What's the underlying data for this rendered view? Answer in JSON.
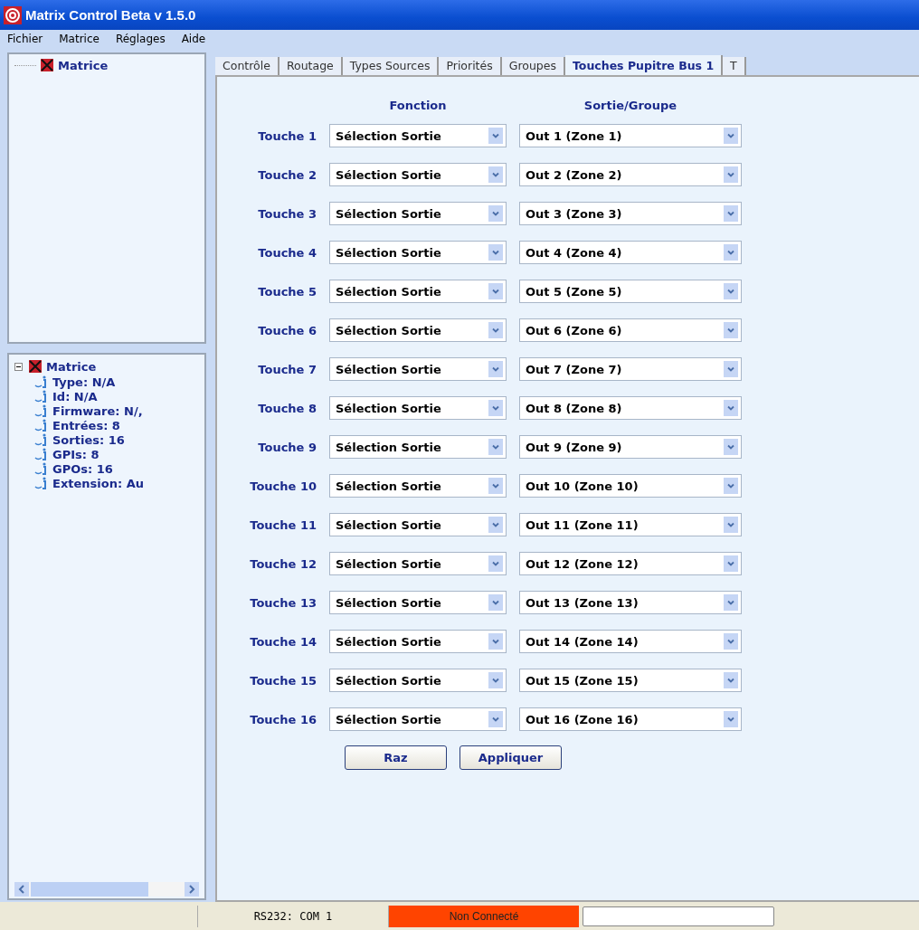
{
  "window": {
    "title": "Matrix Control Beta v 1.5.0"
  },
  "menu": [
    "Fichier",
    "Matrice",
    "Réglages",
    "Aide"
  ],
  "device_list": {
    "items": [
      {
        "label": "Matrice",
        "selected": false
      }
    ]
  },
  "info_tree": {
    "label": "Matrice",
    "expanded": true,
    "children": [
      {
        "label": "Type: N/A"
      },
      {
        "label": "Id: N/A"
      },
      {
        "label": "Firmware: N/,"
      },
      {
        "label": "Entrées: 8"
      },
      {
        "label": "Sorties: 16"
      },
      {
        "label": "GPIs: 8"
      },
      {
        "label": "GPOs: 16"
      },
      {
        "label": "Extension: Au"
      }
    ]
  },
  "tabs": [
    {
      "label": "Contrôle",
      "selected": false
    },
    {
      "label": "Routage",
      "selected": false
    },
    {
      "label": "Types Sources",
      "selected": false
    },
    {
      "label": "Priorités",
      "selected": false
    },
    {
      "label": "Groupes",
      "selected": false
    },
    {
      "label": "Touches Pupitre Bus 1",
      "selected": true
    },
    {
      "label": "T",
      "selected": false
    }
  ],
  "columns": [
    "Fonction",
    "Sortie/Groupe"
  ],
  "keys": [
    {
      "label": "Touche 1",
      "function": "Sélection Sortie",
      "output": "Out 1 (Zone 1)"
    },
    {
      "label": "Touche 2",
      "function": "Sélection Sortie",
      "output": "Out 2 (Zone 2)"
    },
    {
      "label": "Touche 3",
      "function": "Sélection Sortie",
      "output": "Out 3 (Zone 3)"
    },
    {
      "label": "Touche 4",
      "function": "Sélection Sortie",
      "output": "Out 4 (Zone 4)"
    },
    {
      "label": "Touche 5",
      "function": "Sélection Sortie",
      "output": "Out 5 (Zone 5)"
    },
    {
      "label": "Touche 6",
      "function": "Sélection Sortie",
      "output": "Out 6 (Zone 6)"
    },
    {
      "label": "Touche 7",
      "function": "Sélection Sortie",
      "output": "Out 7 (Zone 7)"
    },
    {
      "label": "Touche 8",
      "function": "Sélection Sortie",
      "output": "Out 8 (Zone 8)"
    },
    {
      "label": "Touche 9",
      "function": "Sélection Sortie",
      "output": "Out 9 (Zone 9)"
    },
    {
      "label": "Touche 10",
      "function": "Sélection Sortie",
      "output": "Out 10 (Zone 10)"
    },
    {
      "label": "Touche 11",
      "function": "Sélection Sortie",
      "output": "Out 11 (Zone 11)"
    },
    {
      "label": "Touche 12",
      "function": "Sélection Sortie",
      "output": "Out 12 (Zone 12)"
    },
    {
      "label": "Touche 13",
      "function": "Sélection Sortie",
      "output": "Out 13 (Zone 13)"
    },
    {
      "label": "Touche 14",
      "function": "Sélection Sortie",
      "output": "Out 14 (Zone 14)"
    },
    {
      "label": "Touche 15",
      "function": "Sélection Sortie",
      "output": "Out 15 (Zone 15)"
    },
    {
      "label": "Touche 16",
      "function": "Sélection Sortie",
      "output": "Out 16 (Zone 16)"
    }
  ],
  "buttons": [
    "Raz",
    "Appliquer"
  ],
  "status_bar": {
    "port": "RS232: COM 1",
    "connection": "Non Connecté",
    "connected": false
  }
}
